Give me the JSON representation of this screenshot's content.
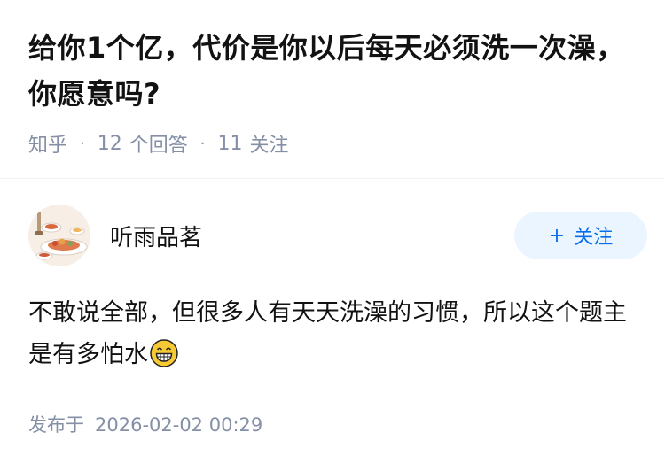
{
  "question": {
    "title": "给你1个亿，代价是你以后每天必须洗一次澡，你愿意吗?",
    "source": "知乎",
    "answers_count": "12",
    "answers_label": "个回答",
    "followers_count": "11",
    "followers_label": "关注"
  },
  "answer": {
    "author_name": "听雨品茗",
    "follow_plus": "+",
    "follow_label": "关注",
    "content": "不敢说全部，但很多人有天天洗澡的习惯，所以这个题主是有多怕水",
    "emoji_icon": "grinning-face-icon",
    "published_label": "发布于",
    "published_time": "2026-02-02 00:29"
  },
  "colors": {
    "meta_gray": "#8590a6",
    "accent_blue": "#056de8",
    "button_bg": "#ebf5ff"
  }
}
